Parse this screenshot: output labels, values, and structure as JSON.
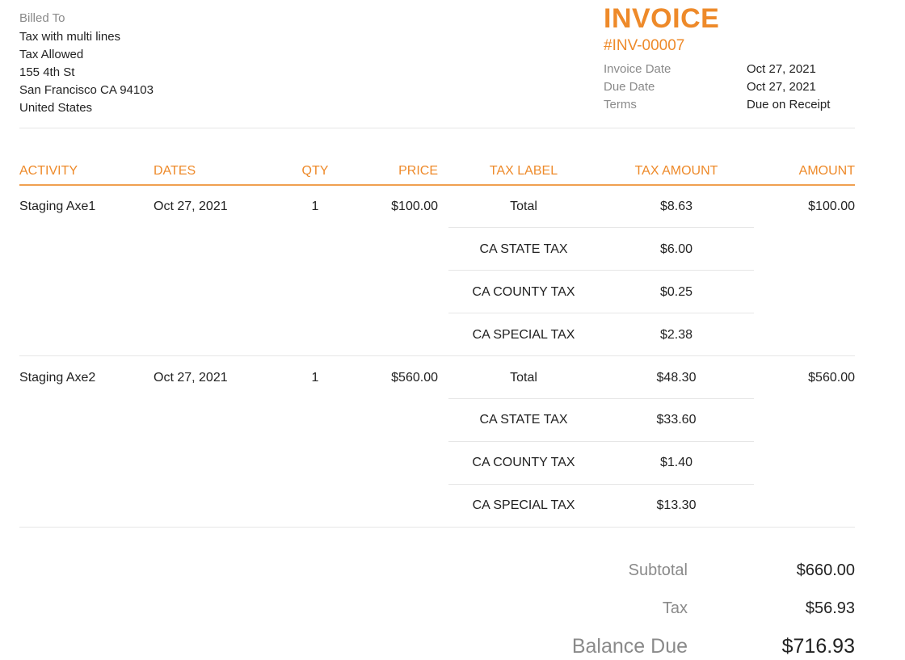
{
  "billed_to": {
    "label": "Billed To",
    "lines": [
      "Tax with multi lines",
      "Tax Allowed",
      "155 4th St",
      "San Francisco CA 94103",
      "United States"
    ]
  },
  "invoice": {
    "title": "INVOICE",
    "number": "#INV-00007",
    "meta": [
      {
        "label": "Invoice Date",
        "value": "Oct 27, 2021"
      },
      {
        "label": "Due Date",
        "value": "Oct 27, 2021"
      },
      {
        "label": "Terms",
        "value": "Due on Receipt"
      }
    ]
  },
  "table": {
    "headers": {
      "activity": "ACTIVITY",
      "dates": "DATES",
      "qty": "QTY",
      "price": "PRICE",
      "tax_label": "TAX LABEL",
      "tax_amount": "TAX AMOUNT",
      "amount": "AMOUNT"
    },
    "items": [
      {
        "activity": "Staging Axe1",
        "date": "Oct 27, 2021",
        "qty": "1",
        "price": "$100.00",
        "amount": "$100.00",
        "taxes": [
          {
            "label": "Total",
            "amount": "$8.63"
          },
          {
            "label": "CA STATE TAX",
            "amount": "$6.00"
          },
          {
            "label": "CA COUNTY TAX",
            "amount": "$0.25"
          },
          {
            "label": "CA SPECIAL TAX",
            "amount": "$2.38"
          }
        ]
      },
      {
        "activity": "Staging Axe2",
        "date": "Oct 27, 2021",
        "qty": "1",
        "price": "$560.00",
        "amount": "$560.00",
        "taxes": [
          {
            "label": "Total",
            "amount": "$48.30"
          },
          {
            "label": "CA STATE TAX",
            "amount": "$33.60"
          },
          {
            "label": "CA COUNTY TAX",
            "amount": "$1.40"
          },
          {
            "label": "CA SPECIAL TAX",
            "amount": "$13.30"
          }
        ]
      }
    ]
  },
  "totals": {
    "subtotal_label": "Subtotal",
    "subtotal": "$660.00",
    "tax_label": "Tax",
    "tax": "$56.93",
    "balance_label": "Balance Due",
    "balance": "$716.93"
  },
  "colors": {
    "accent": "#ee8a2a",
    "muted_text": "#8a8a8a",
    "divider": "#e6e6e6"
  }
}
